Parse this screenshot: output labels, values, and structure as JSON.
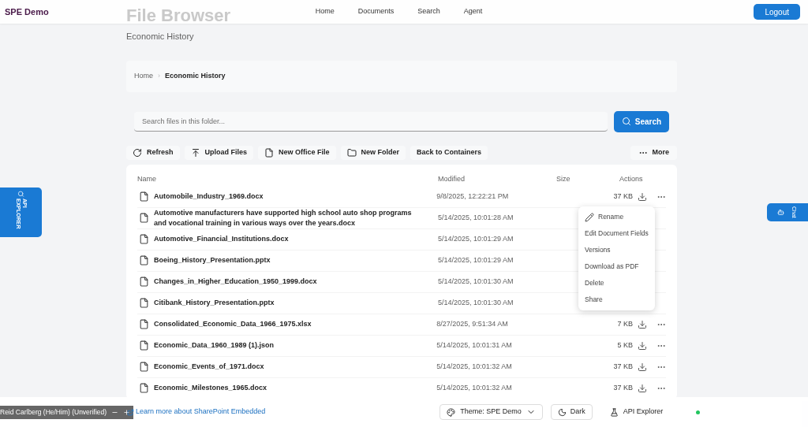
{
  "header": {
    "logo": "SPE Demo",
    "nav": [
      {
        "label": "Home"
      },
      {
        "label": "Documents"
      },
      {
        "label": "Search"
      },
      {
        "label": "Agent"
      }
    ],
    "logout": "Logout"
  },
  "page": {
    "title": "File Browser",
    "subtitle": "Economic History"
  },
  "breadcrumb": {
    "separator": "›",
    "items": [
      {
        "label": "Home",
        "selected": false
      },
      {
        "label": "Economic History",
        "selected": true
      }
    ]
  },
  "search": {
    "placeholder": "Search files in this folder...",
    "button": "Search"
  },
  "toolbar": [
    "Refresh",
    "Upload Files",
    "New Office File",
    "New Folder",
    "Back to Containers"
  ],
  "more": "More",
  "table": {
    "columns": [
      "Name",
      "Modified",
      "Size",
      "Actions"
    ],
    "rows": [
      {
        "name": "Automobile_Industry_1969.docx",
        "modified": "9/8/2025, 12:22:21 PM",
        "size": "37 KB"
      },
      {
        "name": "Automotive manufacturers have supported high school auto shop programs and vocational training in various ways over the years.docx",
        "modified": "5/14/2025, 10:01:28 AM"
      },
      {
        "name": "Automotive_Financial_Institutions.docx",
        "modified": "5/14/2025, 10:01:29 AM"
      },
      {
        "name": "Boeing_History_Presentation.pptx",
        "modified": "5/14/2025, 10:01:29 AM"
      },
      {
        "name": "Changes_in_Higher_Education_1950_1999.docx",
        "modified": "5/14/2025, 10:01:30 AM"
      },
      {
        "name": "Citibank_History_Presentation.pptx",
        "modified": "5/14/2025, 10:01:30 AM"
      },
      {
        "name": "Consolidated_Economic_Data_1966_1975.xlsx",
        "modified": "8/27/2025, 9:51:34 AM",
        "size": "7 KB"
      },
      {
        "name": "Economic_Data_1960_1989 (1).json",
        "modified": "5/14/2025, 10:01:31 AM",
        "size": "5 KB"
      },
      {
        "name": "Economic_Events_of_1971.docx",
        "modified": "5/14/2025, 10:01:32 AM",
        "size": "37 KB"
      },
      {
        "name": "Economic_Milestones_1965.docx",
        "modified": "5/14/2025, 10:01:32 AM",
        "size": "37 KB"
      }
    ]
  },
  "context_menu": [
    "Rename",
    "Edit Document Fields",
    "Versions",
    "Download as PDF",
    "Delete",
    "Share"
  ],
  "side_tabs": {
    "left": "API EXPLORER",
    "right": "Chat"
  },
  "footer": {
    "link": "Learn more about SharePoint Embedded",
    "theme": "Theme: SPE Demo",
    "dark": "Dark",
    "api": "API Explorer"
  },
  "call_overlay": {
    "name": "Reid Carlberg (He/Him) (Unverified)"
  }
}
